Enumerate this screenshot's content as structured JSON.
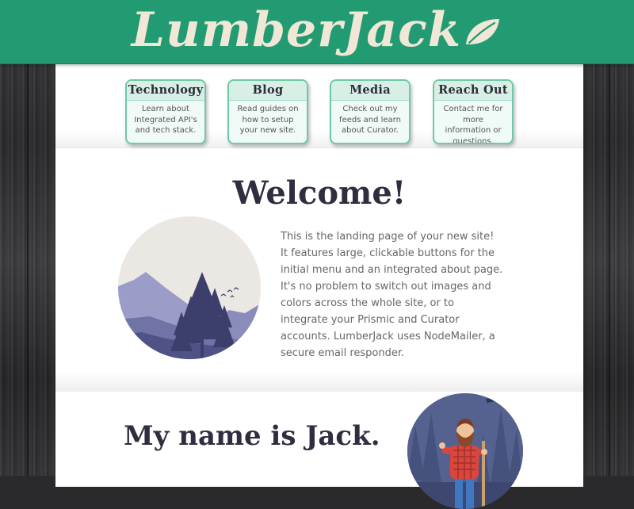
{
  "header": {
    "logo_text": "LumberJack",
    "logo_icon": "leaf-icon"
  },
  "nav": [
    {
      "title": "Technology",
      "desc": "Learn about Integrated API's and tech stack."
    },
    {
      "title": "Blog",
      "desc": "Read guides on how to setup your new site."
    },
    {
      "title": "Media",
      "desc": "Check out my feeds and learn about Curator."
    },
    {
      "title": "Reach Out",
      "desc": "Contact me for more information or questions."
    }
  ],
  "welcome": {
    "heading": "Welcome!",
    "text": "This is the landing page of your new site! It features large, clickable buttons for the initial menu and an integrated about page. It's no problem to switch out images and colors across the whole site, or to integrate your Prismic and Curator accounts. LumberJack uses NodeMailer, a secure email responder."
  },
  "about": {
    "heading": "My name is Jack."
  },
  "colors": {
    "header": "#229a72",
    "accent": "#6ec9a8",
    "heading": "#2e2e40",
    "logo": "#f1e7d6"
  }
}
